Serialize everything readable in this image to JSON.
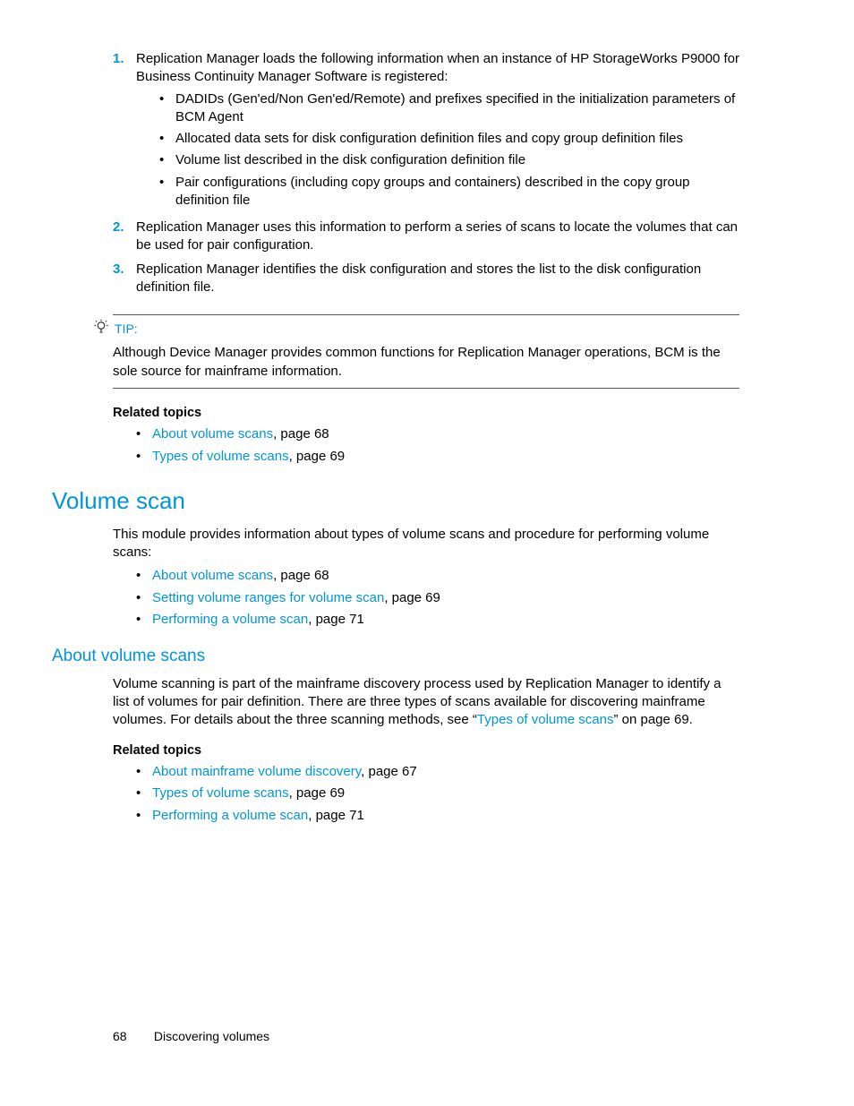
{
  "ordered": {
    "items": [
      {
        "num": "1.",
        "text": "Replication Manager loads the following information when an instance of HP StorageWorks P9000 for Business Continuity Manager Software is registered:",
        "sub": [
          "DADIDs (Gen'ed/Non Gen'ed/Remote) and prefixes specified in the initialization parameters of BCM Agent",
          "Allocated data sets for disk configuration definition files and copy group definition files",
          "Volume list described in the disk configuration definition file",
          "Pair configurations (including copy groups and containers) described in the copy group definition file"
        ]
      },
      {
        "num": "2.",
        "text": "Replication Manager uses this information to perform a series of scans to locate the volumes that can be used for pair configuration."
      },
      {
        "num": "3.",
        "text": "Replication Manager identifies the disk configuration and stores the list to the disk configuration definition file."
      }
    ]
  },
  "tip": {
    "label": "TIP:",
    "text": "Although Device Manager provides common functions for Replication Manager operations, BCM is the sole source for mainframe information."
  },
  "related1": {
    "heading": "Related topics",
    "items": [
      {
        "link": "About volume scans",
        "after": ", page 68"
      },
      {
        "link": "Types of volume scans",
        "after": ", page 69"
      }
    ]
  },
  "h1": "Volume scan",
  "intro": "This module provides information about types of volume scans and procedure for performing volume scans:",
  "vs_links": [
    {
      "link": "About volume scans",
      "after": ", page 68"
    },
    {
      "link": "Setting volume ranges for volume scan",
      "after": ", page 69"
    },
    {
      "link": "Performing a volume scan",
      "after": ", page 71"
    }
  ],
  "h2": "About volume scans",
  "about": {
    "pre": "Volume scanning is part of the mainframe discovery process used by Replication Manager to identify a list of volumes for pair definition. There are three types of scans available for discovering mainframe volumes. For details about the three scanning methods, see “",
    "link": "Types of volume scans",
    "post": "” on page 69."
  },
  "related2": {
    "heading": "Related topics",
    "items": [
      {
        "link": "About mainframe volume discovery",
        "after": ", page 67"
      },
      {
        "link": "Types of volume scans",
        "after": ", page 69"
      },
      {
        "link": "Performing a volume scan",
        "after": ", page 71"
      }
    ]
  },
  "footer": {
    "pagenum": "68",
    "section": "Discovering volumes"
  }
}
